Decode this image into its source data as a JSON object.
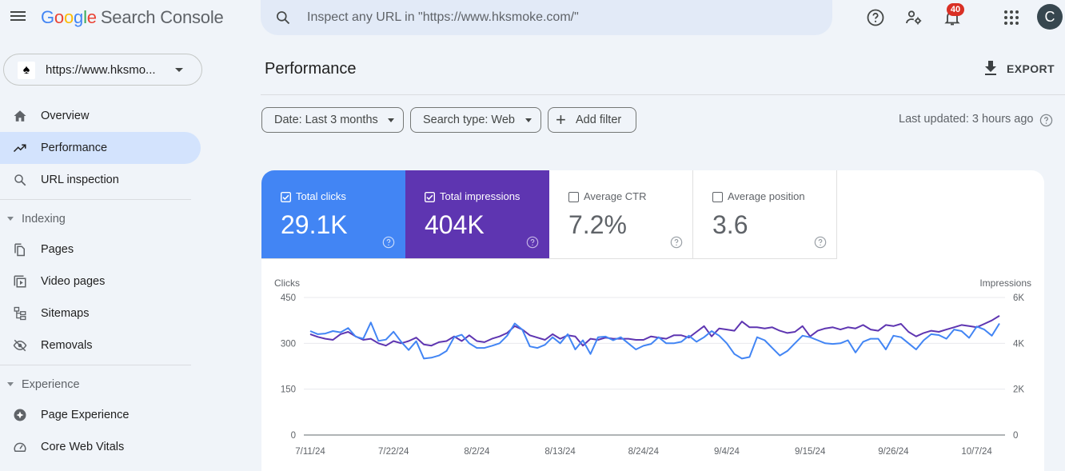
{
  "app": {
    "title_brand": [
      "G",
      "o",
      "o",
      "g",
      "l",
      "e"
    ],
    "title_product": "Search Console"
  },
  "search": {
    "placeholder": "Inspect any URL in \"https://www.hksmoke.com/\"",
    "value": ""
  },
  "toolbar": {
    "notifications_count": "40",
    "avatar_initial": "C"
  },
  "property": {
    "url": "https://www.hksmo...",
    "favicon": "♠"
  },
  "nav": {
    "top_items": [
      {
        "label": "Overview",
        "icon": "home-icon"
      },
      {
        "label": "Performance",
        "icon": "trending-up-icon",
        "active": true
      },
      {
        "label": "URL inspection",
        "icon": "search-icon"
      }
    ],
    "sections": [
      {
        "label": "Indexing",
        "items": [
          {
            "label": "Pages",
            "icon": "pages-icon"
          },
          {
            "label": "Video pages",
            "icon": "video-pages-icon"
          },
          {
            "label": "Sitemaps",
            "icon": "sitemap-icon"
          },
          {
            "label": "Removals",
            "icon": "removals-icon"
          }
        ]
      },
      {
        "label": "Experience",
        "items": [
          {
            "label": "Page Experience",
            "icon": "page-experience-icon"
          },
          {
            "label": "Core Web Vitals",
            "icon": "speed-gauge-icon"
          }
        ]
      }
    ]
  },
  "page": {
    "title": "Performance",
    "export_label": "EXPORT",
    "last_updated": "Last updated: 3 hours ago"
  },
  "filters": {
    "date": "Date: Last 3 months",
    "search_type": "Search type: Web",
    "add_filter": "Add filter"
  },
  "metrics": [
    {
      "label": "Total clicks",
      "value": "29.1K",
      "checked": true,
      "color": "#4285f4"
    },
    {
      "label": "Total impressions",
      "value": "404K",
      "checked": true,
      "color": "#5e35b1"
    },
    {
      "label": "Average CTR",
      "value": "7.2%",
      "checked": false
    },
    {
      "label": "Average position",
      "value": "3.6",
      "checked": false
    }
  ],
  "chart_data": {
    "type": "line",
    "title": "",
    "ylabel_left": "Clicks",
    "ylabel_right": "Impressions",
    "ylim_left": [
      0,
      450
    ],
    "ylim_right": [
      0,
      6000
    ],
    "yticks_left": [
      "450",
      "300",
      "150",
      "0"
    ],
    "yticks_right": [
      "6K",
      "4K",
      "2K",
      "0"
    ],
    "xtick_labels": [
      "7/11/24",
      "7/22/24",
      "8/2/24",
      "8/13/24",
      "8/24/24",
      "9/4/24",
      "9/15/24",
      "9/26/24",
      "10/7/24"
    ],
    "x_start": "7/11/24",
    "x_days": 92,
    "grid": true,
    "series": [
      {
        "name": "Clicks",
        "axis": "left",
        "color": "#4285f4",
        "values": [
          340,
          330,
          332,
          340,
          336,
          350,
          322,
          315,
          368,
          308,
          312,
          338,
          305,
          278,
          307,
          250,
          253,
          260,
          275,
          320,
          328,
          300,
          285,
          285,
          292,
          300,
          325,
          365,
          345,
          290,
          285,
          295,
          320,
          300,
          330,
          280,
          310,
          265,
          320,
          322,
          310,
          320,
          300,
          280,
          292,
          298,
          320,
          300,
          300,
          305,
          325,
          305,
          320,
          340,
          325,
          300,
          265,
          250,
          255,
          320,
          310,
          285,
          260,
          275,
          300,
          325,
          320,
          310,
          300,
          298,
          300,
          310,
          270,
          305,
          315,
          315,
          280,
          325,
          320,
          300,
          280,
          310,
          330,
          327,
          315,
          345,
          340,
          318,
          355,
          345,
          325,
          365
        ]
      },
      {
        "name": "Impressions",
        "axis": "left_scaled",
        "color": "#5e35b1",
        "values": [
          4400,
          4280,
          4200,
          4150,
          4400,
          4500,
          4300,
          4150,
          4200,
          4000,
          3900,
          4100,
          4000,
          4100,
          4250,
          3950,
          3900,
          4050,
          4100,
          4300,
          4100,
          4350,
          4100,
          4050,
          4200,
          4300,
          4450,
          4750,
          4600,
          4350,
          4250,
          4150,
          4400,
          4200,
          4350,
          4300,
          3900,
          4200,
          4150,
          4250,
          4200,
          4200,
          4200,
          4150,
          4150,
          4300,
          4250,
          4200,
          4350,
          4350,
          4250,
          4500,
          4750,
          4300,
          4650,
          4600,
          4550,
          4950,
          4700,
          4700,
          4650,
          4700,
          4550,
          4450,
          4500,
          4750,
          4300,
          4550,
          4650,
          4700,
          4600,
          4700,
          4650,
          4800,
          4600,
          4550,
          4800,
          4750,
          4850,
          4500,
          4300,
          4450,
          4550,
          4500,
          4600,
          4700,
          4800,
          4750,
          4700,
          4850,
          5000,
          5200
        ]
      }
    ]
  }
}
